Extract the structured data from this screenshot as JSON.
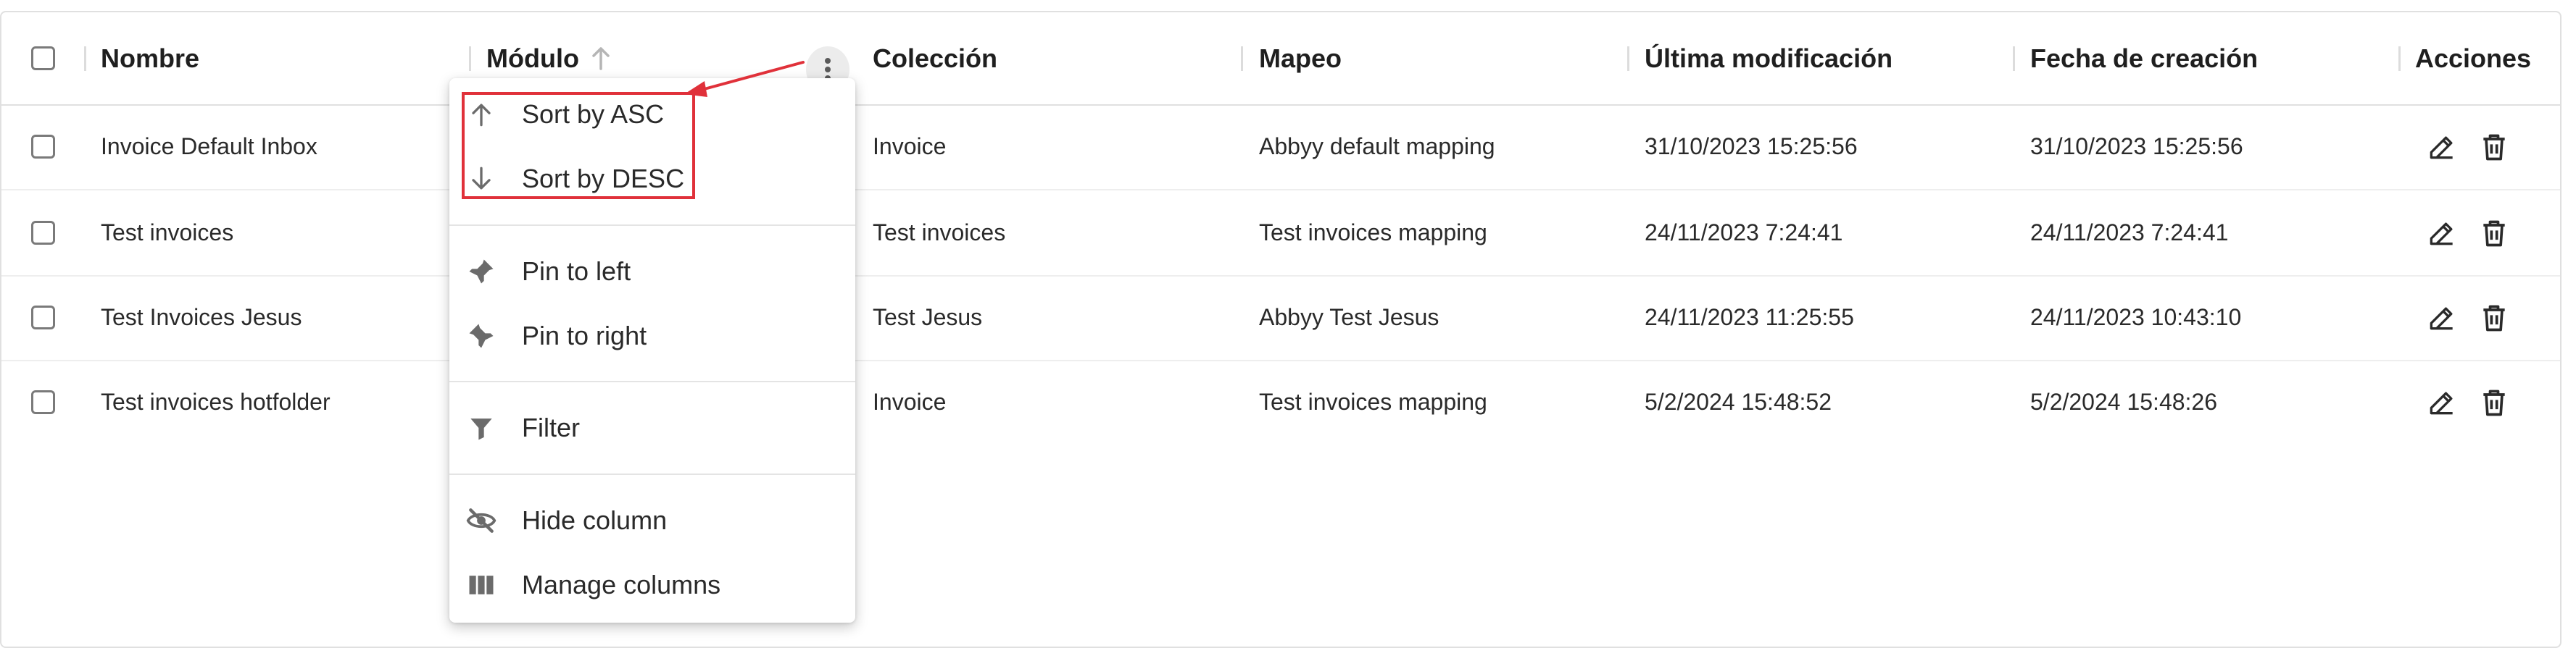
{
  "columns": {
    "nombre": "Nombre",
    "modulo": "Módulo",
    "coleccion": "Colección",
    "mapeo": "Mapeo",
    "ultima_modificacion": "Última modificación",
    "fecha_creacion": "Fecha de creación",
    "acciones": "Acciones"
  },
  "rows": [
    {
      "nombre": "Invoice Default Inbox",
      "coleccion": "Invoice",
      "mapeo": "Abbyy default mapping",
      "ultima": "31/10/2023 15:25:56",
      "creacion": "31/10/2023 15:25:56"
    },
    {
      "nombre": "Test invoices",
      "coleccion": "Test invoices",
      "mapeo": "Test invoices mapping",
      "ultima": "24/11/2023 7:24:41",
      "creacion": "24/11/2023 7:24:41"
    },
    {
      "nombre": "Test Invoices Jesus",
      "coleccion": "Test Jesus",
      "mapeo": "Abbyy Test Jesus",
      "ultima": "24/11/2023 11:25:55",
      "creacion": "24/11/2023 10:43:10"
    },
    {
      "nombre": "Test invoices hotfolder",
      "coleccion": "Invoice",
      "mapeo": "Test invoices mapping",
      "ultima": "5/2/2024 15:48:52",
      "creacion": "5/2/2024 15:48:26"
    }
  ],
  "column_menu": {
    "sort_asc": "Sort by ASC",
    "sort_desc": "Sort by DESC",
    "pin_left": "Pin to left",
    "pin_right": "Pin to right",
    "filter": "Filter",
    "hide_column": "Hide column",
    "manage_columns": "Manage columns"
  },
  "icons": {
    "sort": "arrow-up-icon",
    "column_menu": "kebab-icon",
    "edit": "pencil-icon",
    "delete": "trash-icon",
    "sort_asc": "arrow-up-icon",
    "sort_desc": "arrow-down-icon",
    "pin_left": "pin-icon",
    "pin_right": "pin-icon",
    "filter": "funnel-icon",
    "hide": "eye-off-icon",
    "manage": "columns-icon"
  },
  "colors": {
    "annotation": "#e0313a",
    "border": "#e0e0e0",
    "icon": "#6b6b6b"
  }
}
